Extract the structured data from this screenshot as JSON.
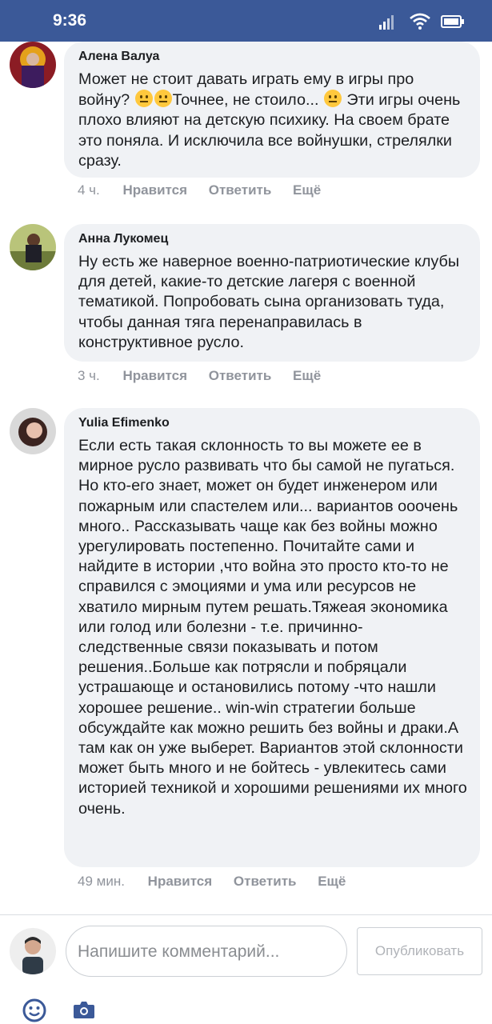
{
  "status_bar": {
    "time": "9:36"
  },
  "comments": [
    {
      "author": "Алена Валуа",
      "text_before": "Может не стоит давать играть ему в игры про войну? ",
      "text_middle": "Точнее, не стоило... ",
      "text_after": " Эти игры очень плохо влияют на детскую психику. На своем брате это поняла. И исключила все войнушки, стрелялки сразу.",
      "time": "4 ч.",
      "like": "Нравится",
      "reply": "Ответить",
      "more": "Ещё"
    },
    {
      "author": "Анна Лукомец",
      "text": "Ну есть же наверное военно-патриотические клубы для детей, какие-то детские лагеря с военной тематикой. Попробовать сына организовать туда, чтобы данная тяга перенаправилась в конструктивное русло.",
      "time": "3 ч.",
      "like": "Нравится",
      "reply": "Ответить",
      "more": "Ещё"
    },
    {
      "author": "Yulia Efimenko",
      "text": "Если есть такая склонность то вы можете ее в мирное русло развивать что бы самой не пугаться. Но кто-его знает, может он будет инженером или пожарным или спастелем или... вариантов ооочень много.. Рассказывать чаще как без войны можно урегулировать постепенно. Почитайте сами и найдите в истории ,что война это просто кто-то не справился с эмоциями и ума или ресурсов не хватило мирным путем решать.Тяжеая экономика или голод или болезни - т.е. причинно- следственные связи показывать и потом решения..Больше как потрясли и побряцали устрашающе и остановились потому -что нашли хорошее решение.. win-win стратегии больше обсуждайте как можно решить без войны и драки.А там как он уже выберет. Вариантов этой склонности может быть много и не бойтесь - увлекитесь сами историей техникой и хорошими решениями их много очень.",
      "time": "49 мин.",
      "like": "Нравится",
      "reply": "Ответить",
      "more": "Ещё"
    }
  ],
  "composer": {
    "placeholder": "Напишите комментарий...",
    "publish_label": "Опубликовать"
  },
  "icons": {
    "signal": "signal-icon",
    "wifi": "wifi-icon",
    "battery": "battery-icon",
    "emoji": "emoji-icon",
    "camera": "camera-icon"
  },
  "colors": {
    "status_bar": "#3b5998",
    "bubble": "#f0f2f5",
    "action_text": "#90949c",
    "accent_icon": "#3b5998"
  }
}
